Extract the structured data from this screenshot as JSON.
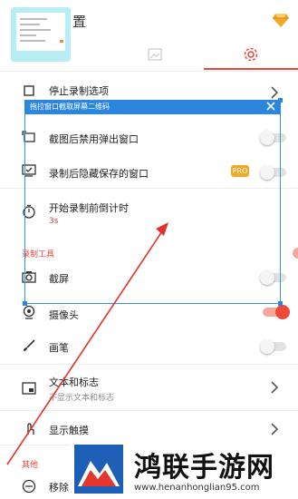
{
  "header": {
    "title_tail": "置",
    "brand_accent": "#e6453c"
  },
  "tabs": [
    {
      "icon": "image-icon",
      "active": false
    },
    {
      "icon": "gear-icon",
      "active": true
    }
  ],
  "overlay": {
    "title": "拖拉窗口截取屏幕二维码"
  },
  "settings": {
    "stop_record_options": "停止录制选项",
    "disable_popup": "截图后禁用弹出窗口",
    "hide_saved_window": "录制后隐藏保存的窗口",
    "pro_badge": "PRO",
    "countdown": "开始录制前倒计时",
    "countdown_value": "3s",
    "section_tools": "录制工具",
    "screenshot": "截屏",
    "camera": "摄像头",
    "brush": "画笔",
    "text_logo": "文本和标志",
    "text_logo_sub": "不显示文本和标志",
    "show_touches": "显示触摸",
    "section_other": "其他",
    "remove_tail": "移除"
  },
  "toggles": {
    "disable_popup": false,
    "hide_saved_window": false,
    "screenshot": false,
    "camera": true,
    "brush": false
  },
  "watermark": {
    "title": "鸿联手游网",
    "url": "www.henanhonglian95.com"
  }
}
